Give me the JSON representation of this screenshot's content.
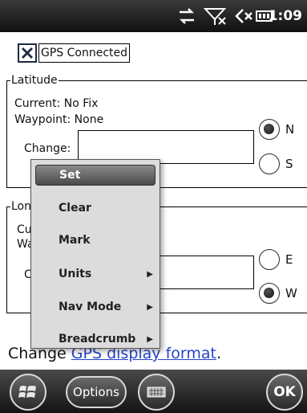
{
  "status": {
    "time": "1:09"
  },
  "gps": {
    "label": "GPS Connected",
    "checked": true
  },
  "latitude": {
    "title": "Latitude",
    "current": "Current: No Fix",
    "waypoint": "Waypoint: None",
    "change_label": "Change:",
    "options": [
      "N",
      "S"
    ],
    "selected": "N"
  },
  "longitude": {
    "title": "Lon",
    "current_partial": "Cu",
    "waypoint_partial": "Wa",
    "change_partial": "C",
    "options": [
      "E",
      "W"
    ],
    "selected": "W"
  },
  "format_line": {
    "prefix": "Change ",
    "link": "GPS display format",
    "suffix": "."
  },
  "menu": {
    "items": [
      {
        "label": "Set",
        "selected": true,
        "submenu": false
      },
      {
        "label": "Clear",
        "selected": false,
        "submenu": false
      },
      {
        "label": "Mark",
        "selected": false,
        "submenu": false
      },
      {
        "label": "Units",
        "selected": false,
        "submenu": true
      },
      {
        "label": "Nav Mode",
        "selected": false,
        "submenu": true
      },
      {
        "label": "Breadcrumb",
        "selected": false,
        "submenu": true
      }
    ],
    "submenu_arrow": "▶"
  },
  "softkeys": {
    "options_label": "Options",
    "ok_label": "OK"
  },
  "icons": {
    "status": [
      "sync-icon",
      "no-signal-icon",
      "volume-mute-icon",
      "battery-icon"
    ],
    "softkeys": [
      "windows-start-icon",
      "keyboard-icon"
    ]
  },
  "colors": {
    "link": "#2545c8",
    "menu_bg": "#dcdcdc",
    "menu_selected": "#6a6a6a"
  }
}
